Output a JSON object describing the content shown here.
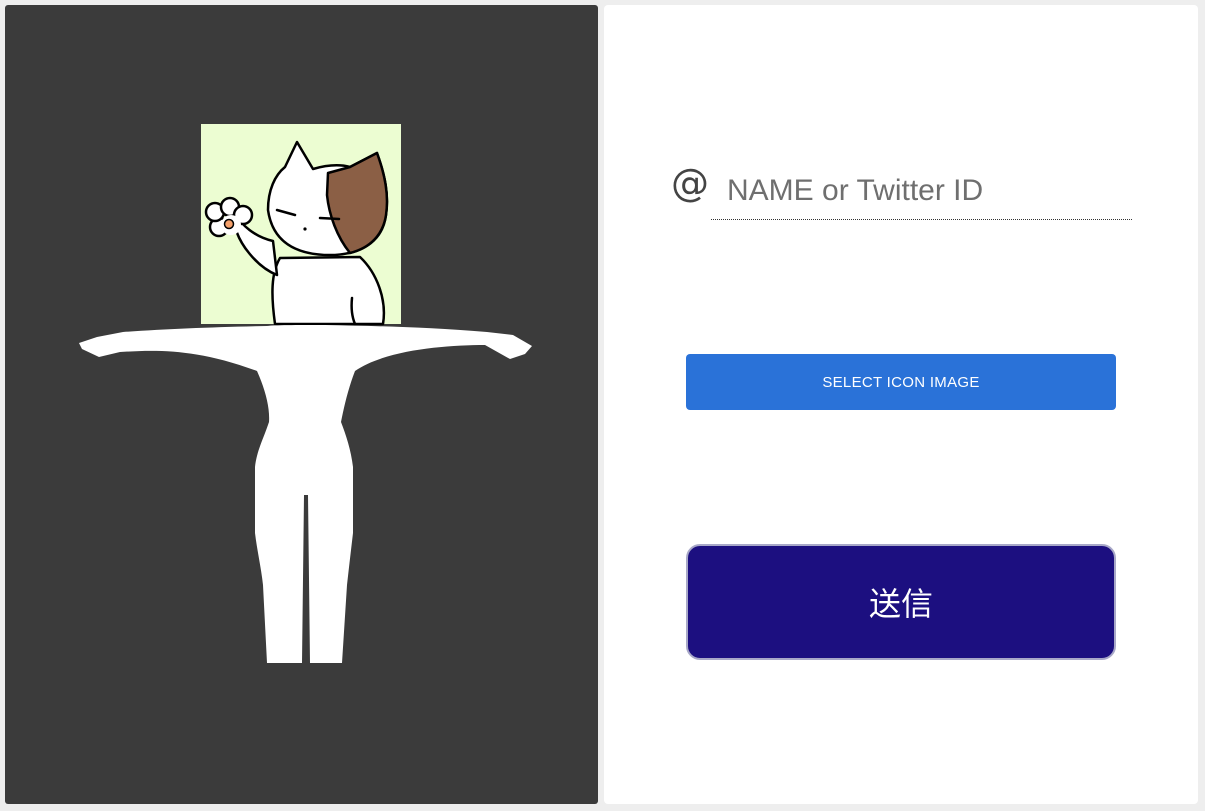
{
  "left_panel": {
    "background_color": "#3b3b3b",
    "avatar_icon_background": "#ecfdd2",
    "cat_patch_color": "#8b5f45",
    "paw_pad_color": "#f4a06a",
    "body_color": "#ffffff"
  },
  "form": {
    "at_symbol": "@",
    "name_field_value": "",
    "name_field_placeholder": "NAME or Twitter ID",
    "select_icon_label": "SELECT ICON IMAGE",
    "select_icon_color": "#2a72d8",
    "send_label": "送信",
    "send_color": "#1c0f80"
  }
}
